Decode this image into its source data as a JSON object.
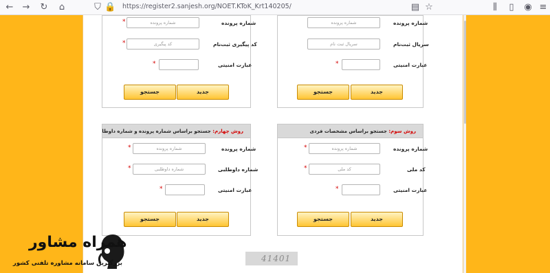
{
  "browser": {
    "url": "https://register2.sanjesh.org/NOET.KToK_Krt140205/"
  },
  "panels": {
    "top_right": {
      "rows": [
        {
          "label": "شماره پرونده",
          "placeholder": "شماره پرونده"
        },
        {
          "label": "سریال ثبت‌نام",
          "placeholder": "سریال ثبت نام"
        },
        {
          "label": "عبارت امنیتی",
          "placeholder": ""
        }
      ],
      "new_button": "جدید",
      "search_button": "جستجو"
    },
    "top_left": {
      "rows": [
        {
          "label": "شماره پرونده",
          "placeholder": "شماره پرونده"
        },
        {
          "label": "کد پیگیری ثبت‌نام",
          "placeholder": "کد پیگیری"
        },
        {
          "label": "عبارت امنیتی",
          "placeholder": ""
        }
      ],
      "new_button": "جدید",
      "search_button": "جستجو"
    },
    "bottom_right": {
      "header_prefix": "روش سوم:",
      "header_text": " جستجو براساس مشخصات فردی",
      "rows": [
        {
          "label": "شماره پرونده",
          "placeholder": "شماره پرونده"
        },
        {
          "label": "کد ملی",
          "placeholder": "کد ملی"
        },
        {
          "label": "عبارت امنیتی",
          "placeholder": ""
        }
      ],
      "new_button": "جدید",
      "search_button": "جستجو"
    },
    "bottom_left": {
      "header_prefix": "روش چهارم:",
      "header_text": " جستجو براساس شماره پرونده و شماره داوطلبی",
      "rows": [
        {
          "label": "شماره پرونده",
          "placeholder": "شماره پرونده"
        },
        {
          "label": "شماره داوطلبی",
          "placeholder": "شماره داوطلبی"
        },
        {
          "label": "عبارت امنیتی",
          "placeholder": ""
        }
      ],
      "new_button": "جدید",
      "search_button": "جستجو"
    }
  },
  "required_mark": "*",
  "captcha": {
    "text": "41401"
  },
  "logo": {
    "title": "همراه مشاور",
    "subtitle": "بزرگترین سامانه مشاوره تلفنی کشور"
  },
  "colors": {
    "background": "#ffb619",
    "required": "#d40000",
    "button": "#ffc533"
  }
}
